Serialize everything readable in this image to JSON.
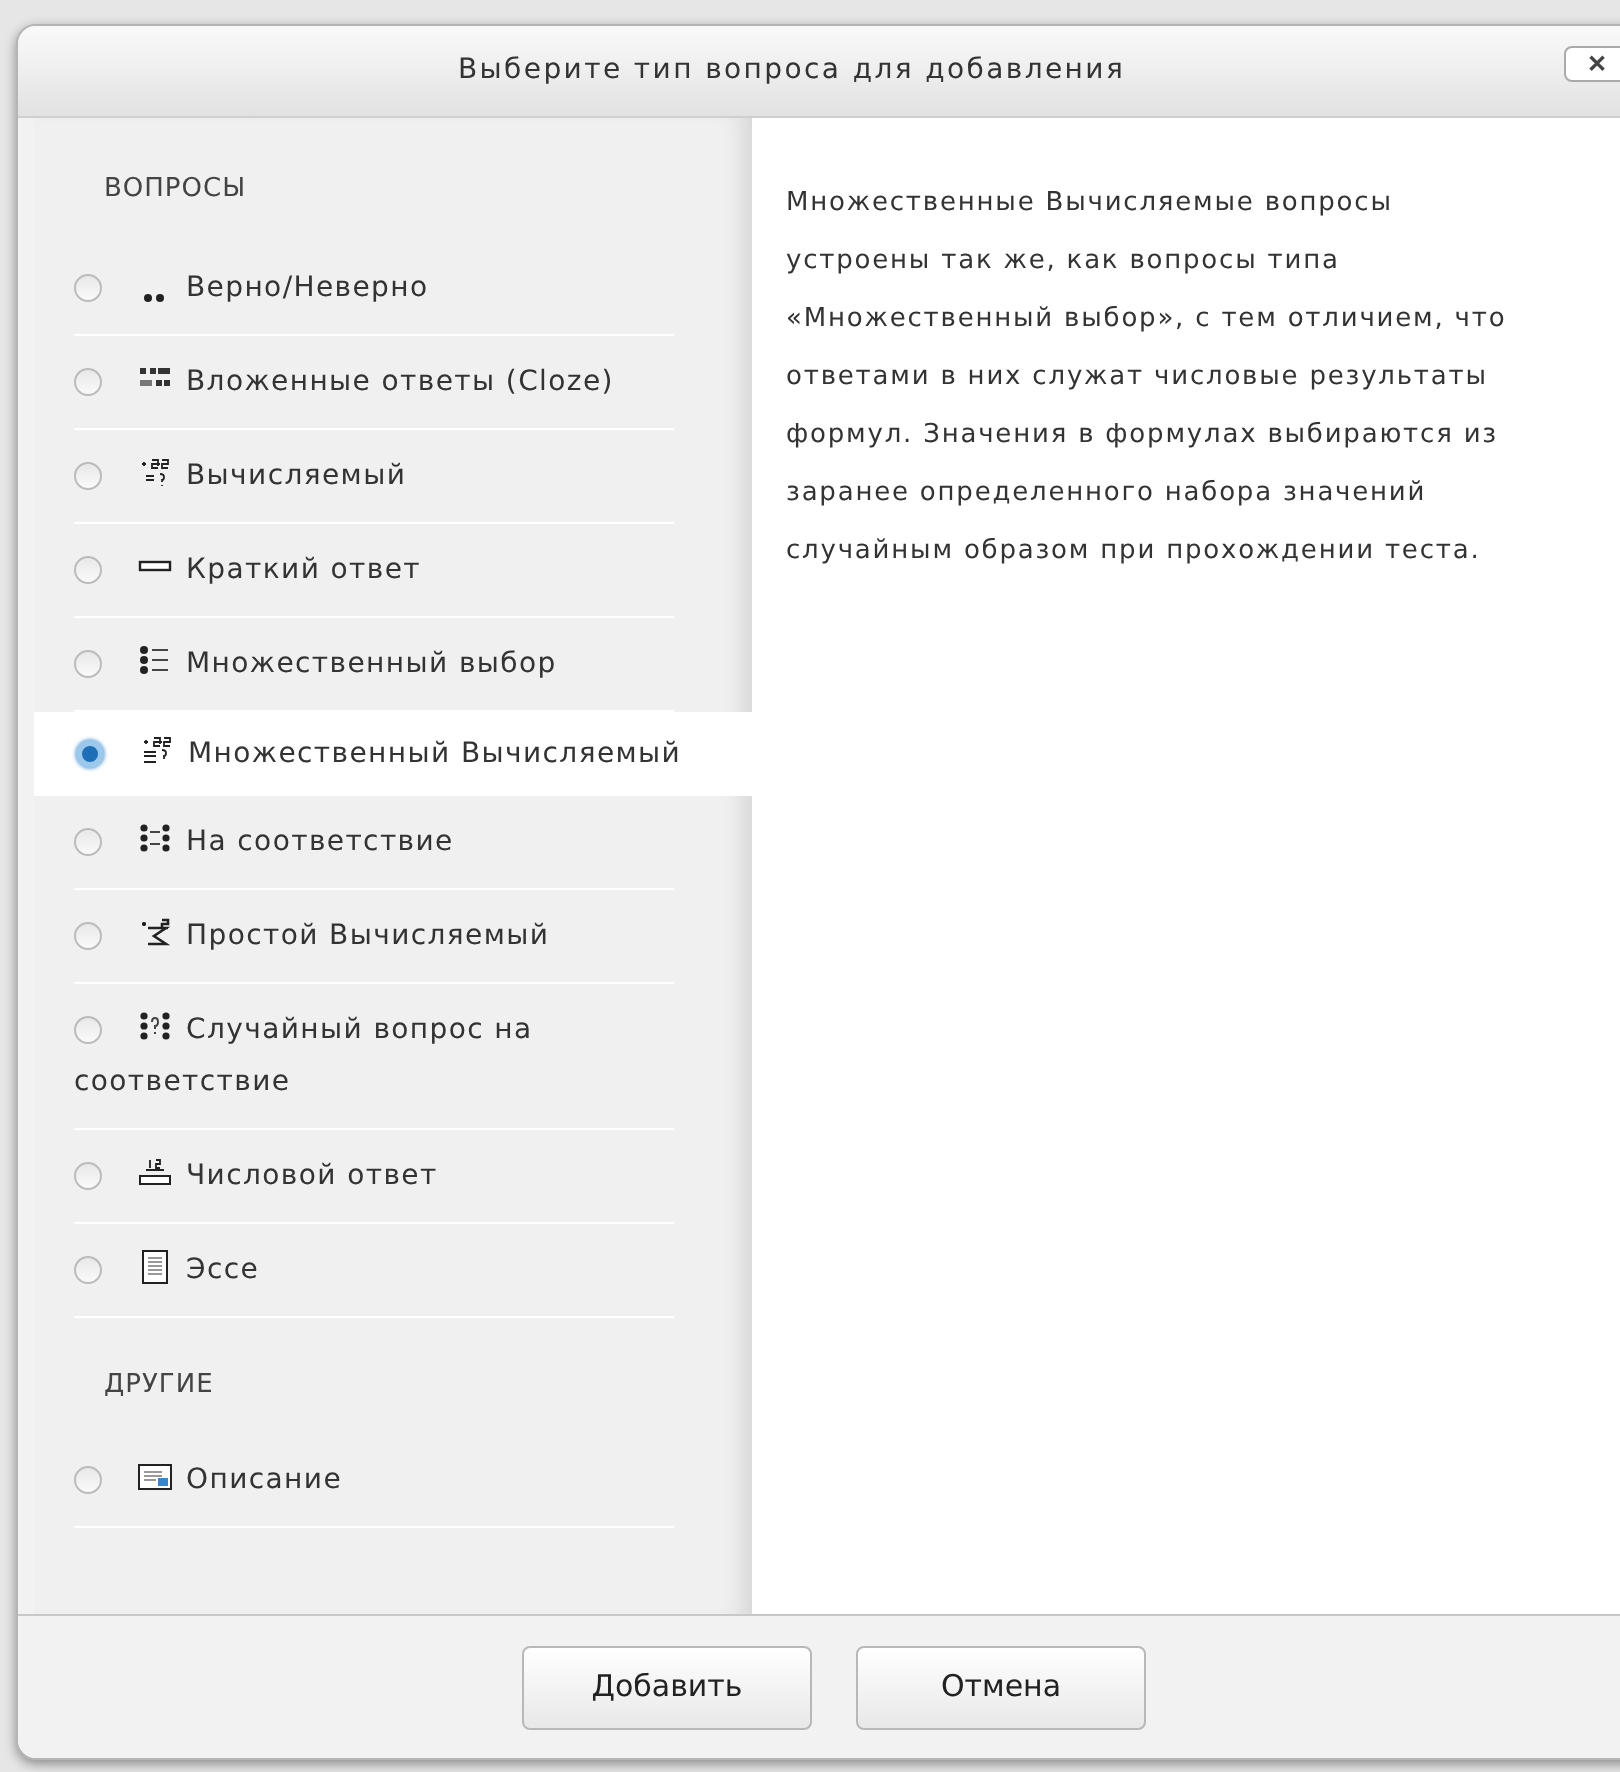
{
  "dialog": {
    "title": "Выберите тип вопроса для добавления",
    "close": "✕"
  },
  "sections": [
    {
      "heading": "ВОПРОСЫ",
      "items": [
        {
          "label": "Верно/Неверно",
          "selected": false
        },
        {
          "label": "Вложенные ответы (Cloze)",
          "selected": false
        },
        {
          "label": "Вычисляемый",
          "selected": false
        },
        {
          "label": "Краткий ответ",
          "selected": false
        },
        {
          "label": "Множественный выбор",
          "selected": false
        },
        {
          "label": "Множественный Вычисляемый",
          "selected": true
        },
        {
          "label": "На соответствие",
          "selected": false
        },
        {
          "label": "Простой Вычисляемый",
          "selected": false
        },
        {
          "label": "Случайный вопрос на соответствие",
          "selected": false
        },
        {
          "label": "Числовой ответ",
          "selected": false
        },
        {
          "label": "Эссе",
          "selected": false
        }
      ]
    },
    {
      "heading": "ДРУГИЕ",
      "items": [
        {
          "label": "Описание",
          "selected": false
        }
      ]
    }
  ],
  "description": "Множественные Вычисляемые вопросы устроены так же, как вопросы типа «Множественный выбор», с тем отличием, что ответами в них служат числовые результаты формул. Значения в формулах выбираются из заранее определенного набора значений случайным образом при прохождении теста.",
  "buttons": [
    "Добавить",
    "Отмена"
  ]
}
